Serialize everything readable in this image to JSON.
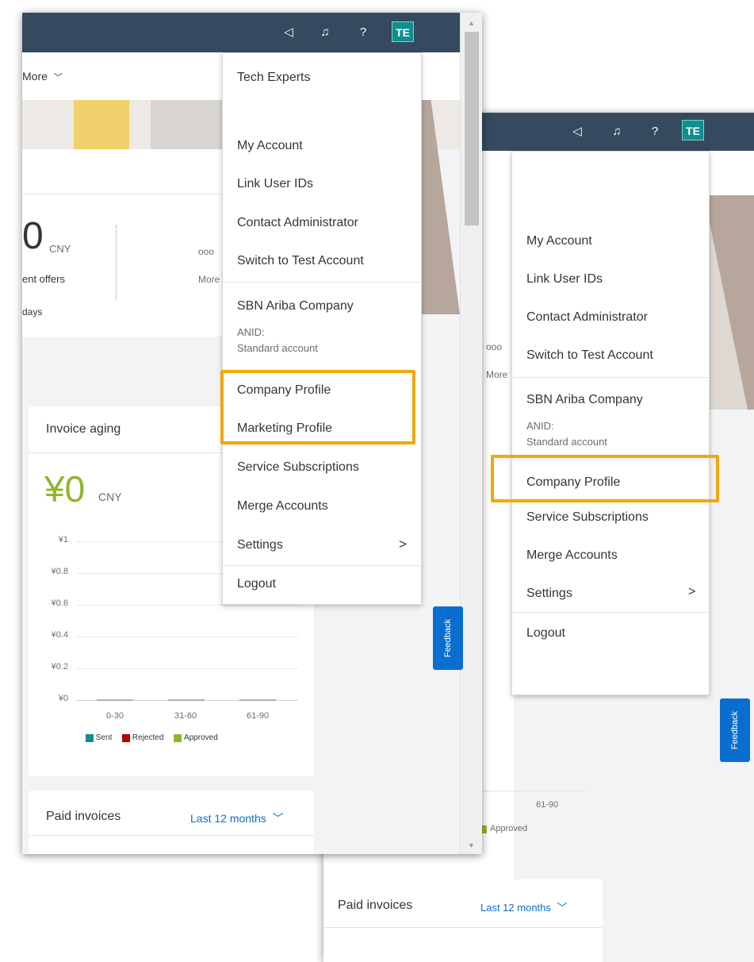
{
  "header": {
    "avatar_initials": "TE"
  },
  "toolbar": {
    "more_label": "More"
  },
  "menu": {
    "user_name": "Tech Experts",
    "my_account": "My Account",
    "link_user_ids": "Link User IDs",
    "contact_admin": "Contact Administrator",
    "switch_test": "Switch to Test Account",
    "company_name": "SBN Ariba Company",
    "anid_label": "ANID:",
    "account_type": "Standard account",
    "company_profile": "Company Profile",
    "marketing_profile": "Marketing Profile",
    "service_subscriptions": "Service Subscriptions",
    "merge_accounts": "Merge Accounts",
    "settings": "Settings",
    "logout": "Logout"
  },
  "summary": {
    "big_value": "0",
    "currency": "CNY",
    "label": "ent offers",
    "sublabel": "days",
    "more_dots": "ooo",
    "more_label": "More"
  },
  "invoice_aging": {
    "title": "Invoice aging",
    "amount": "¥0",
    "currency": "CNY"
  },
  "chart_data": {
    "type": "bar",
    "categories": [
      "0-30",
      "31-60",
      "61-90"
    ],
    "series": [
      {
        "name": "Sent",
        "values": [
          0,
          0,
          0
        ]
      },
      {
        "name": "Rejected",
        "values": [
          0,
          0,
          0
        ]
      },
      {
        "name": "Approved",
        "values": [
          0,
          0,
          0
        ]
      }
    ],
    "y_ticks": [
      "¥1",
      "¥0.8",
      "¥0.6",
      "¥0.4",
      "¥0.2",
      "¥0"
    ],
    "ylim": [
      0,
      1
    ],
    "colors": {
      "Sent": "#1b8a8a",
      "Rejected": "#bb0000",
      "Approved": "#8fb52b"
    },
    "legend_position": "bottom",
    "grid": true
  },
  "paid_invoices": {
    "title": "Paid invoices",
    "period": "Last 12 months"
  },
  "feedback_label": "Feedback",
  "colors": {
    "header": "#354a5f",
    "highlight": "#f0a80c",
    "accent_blue": "#0a6ed1",
    "amount_green": "#8fb52b"
  }
}
